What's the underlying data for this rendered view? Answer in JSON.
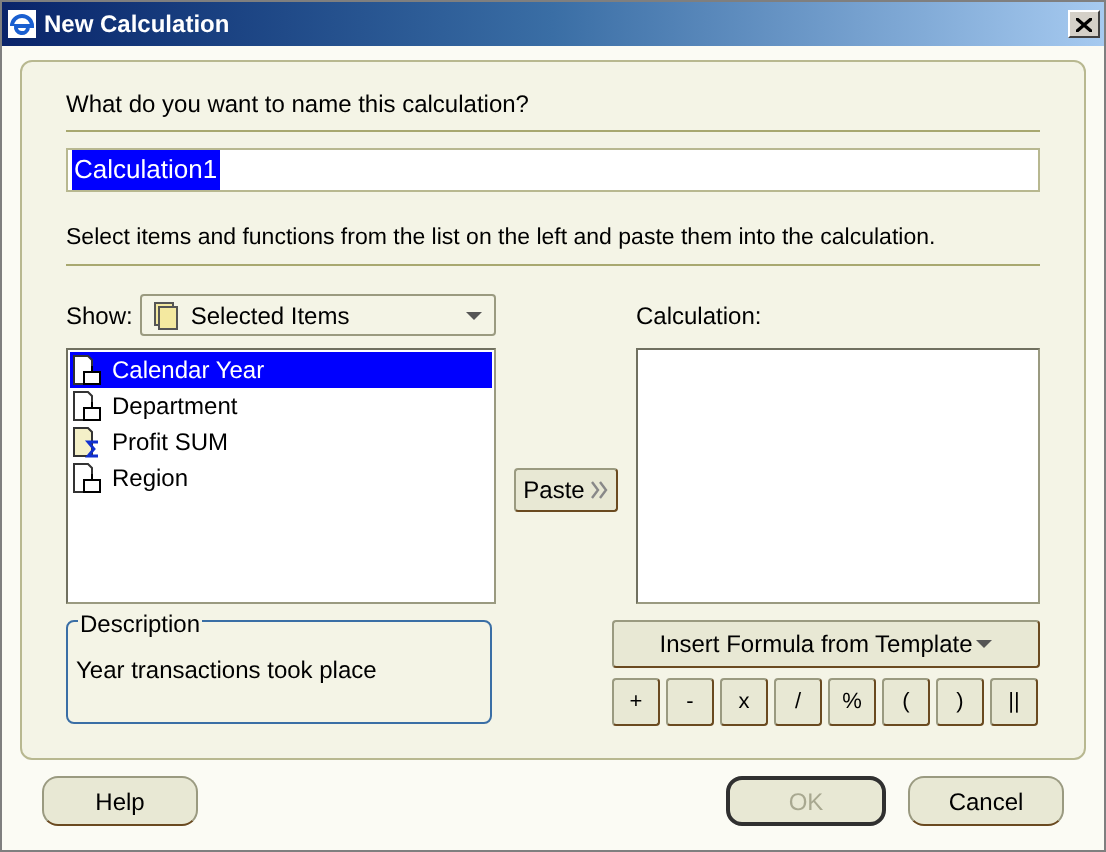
{
  "window": {
    "title": "New Calculation"
  },
  "name_prompt": "What do you want to name this calculation?",
  "name_field": {
    "value": "Calculation1",
    "selected_text": true
  },
  "instructions": "Select items and functions from the list on the left and paste them into the calculation.",
  "show": {
    "label": "Show:",
    "value": "Selected Items"
  },
  "items": [
    {
      "label": "Calendar Year",
      "kind": "attribute",
      "selected": true
    },
    {
      "label": "Department",
      "kind": "attribute",
      "selected": false
    },
    {
      "label": "Profit SUM",
      "kind": "measure",
      "selected": false
    },
    {
      "label": "Region",
      "kind": "attribute",
      "selected": false
    }
  ],
  "paste_button": "Paste",
  "calculation": {
    "label": "Calculation:"
  },
  "description": {
    "legend": "Description",
    "text": "Year transactions took place"
  },
  "template_button": "Insert Formula from Template",
  "operators": [
    "+",
    "-",
    "x",
    "/",
    "%",
    "(",
    ")",
    "||"
  ],
  "buttons": [
    {
      "label": "Help",
      "disabled": false
    },
    {
      "label": "OK",
      "disabled": true
    },
    {
      "label": "Cancel",
      "disabled": false
    }
  ]
}
